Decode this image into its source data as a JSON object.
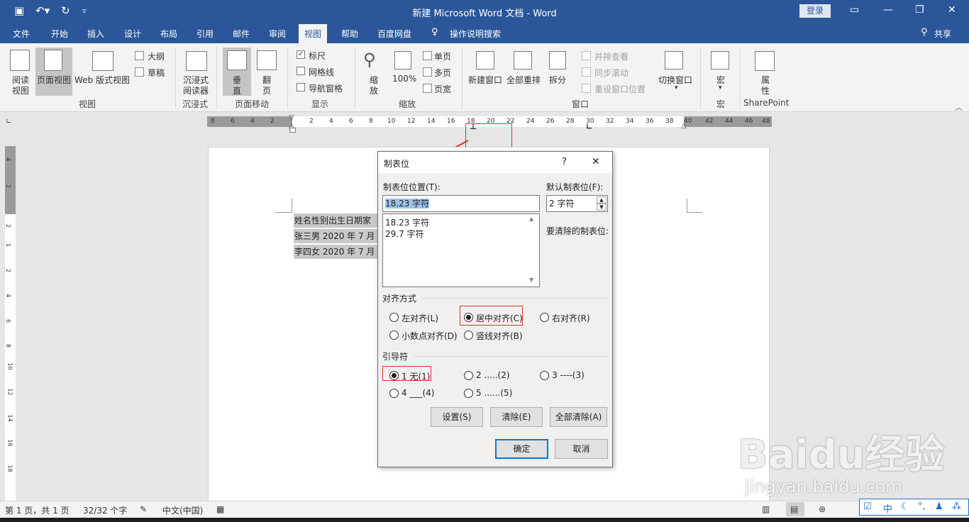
{
  "window": {
    "title": "新建 Microsoft Word 文档  -  Word",
    "login": "登录"
  },
  "tabs": [
    "文件",
    "开始",
    "插入",
    "设计",
    "布局",
    "引用",
    "邮件",
    "审阅",
    "视图",
    "帮助",
    "百度网盘",
    "操作说明搜索"
  ],
  "active_tab": "视图",
  "share": "共享",
  "ribbon": {
    "read_view": "阅读\n视图",
    "read_view_l1": "阅读",
    "read_view_l2": "视图",
    "page_view": "页面视图",
    "web_view": "Web 版式视图",
    "outline": "大纲",
    "draft": "草稿",
    "group_views": "视图",
    "immersive_reader_l1": "沉浸式",
    "immersive_reader_l2": "阅读器",
    "group_immersive": "沉浸式",
    "vertical_l1": "垂",
    "vertical_l2": "直",
    "flip_l1": "翻",
    "flip_l2": "页",
    "group_page_move": "页面移动",
    "ruler": "标尺",
    "gridlines": "网格线",
    "nav_pane": "导航窗格",
    "group_show": "显示",
    "zoom_l1": "缩",
    "zoom_l2": "放",
    "zoom_100": "100%",
    "one_page": "单页",
    "multi_page": "多页",
    "page_width": "页宽",
    "group_zoom": "缩放",
    "new_window": "新建窗口",
    "arrange_all": "全部重排",
    "split": "拆分",
    "side_by_side": "并排查看",
    "sync_scroll": "同步滚动",
    "reset_pos": "重设窗口位置",
    "switch_window": "切换窗口",
    "group_window": "窗口",
    "macros": "宏",
    "group_macros": "宏",
    "properties_l1": "属",
    "properties_l2": "性",
    "group_sharepoint": "SharePoint"
  },
  "ruler_numbers": [
    "8",
    "6",
    "4",
    "2",
    "2",
    "4",
    "6",
    "8",
    "10",
    "12",
    "14",
    "16",
    "18",
    "20",
    "22",
    "24",
    "26",
    "28",
    "30",
    "32",
    "34",
    "36",
    "38",
    "40",
    "42",
    "44",
    "46",
    "48"
  ],
  "vruler_numbers": [
    "4",
    "2",
    "2",
    "1",
    "2",
    "4",
    "6",
    "8",
    "10",
    "12",
    "14",
    "16",
    "18"
  ],
  "document": {
    "lines": [
      "姓名性别出生日期家",
      "张三男 2020 年 7 月",
      "李四女 2020 年 7 月"
    ]
  },
  "dialog": {
    "title": "制表位",
    "help": "?",
    "close": "✕",
    "tab_pos_label": "制表位位置(T):",
    "tab_pos_value": "18.23 字符",
    "default_tab_label": "默认制表位(F):",
    "default_tab_value": "2 字符",
    "tab_list": [
      "18.23 字符",
      "29.7 字符"
    ],
    "clear_label": "要清除的制表位:",
    "align_label": "对齐方式",
    "align_options": [
      "左对齐(L)",
      "居中对齐(C)",
      "右对齐(R)",
      "小数点对齐(D)",
      "竖线对齐(B)"
    ],
    "align_selected": "居中对齐(C)",
    "leader_label": "引导符",
    "leader_options": [
      "1 无(1)",
      "2 .....(2)",
      "3 ----(3)",
      "4 ___(4)",
      "5 ......(5)"
    ],
    "leader_selected": "1 无(1)",
    "btn_set": "设置(S)",
    "btn_clear": "清除(E)",
    "btn_clear_all": "全部清除(A)",
    "btn_ok": "确定",
    "btn_cancel": "取消"
  },
  "statusbar": {
    "page": "第 1 页，共 1 页",
    "words": "32/32 个字",
    "language": "中文(中国)"
  },
  "ime": {
    "mode": "中"
  },
  "watermark": {
    "brand": "Baidu经验",
    "url": "jingyan.baidu.com"
  },
  "colors": {
    "accent": "#2b579a",
    "highlight_red": "#e03030",
    "selection": "#9dc3e6"
  }
}
